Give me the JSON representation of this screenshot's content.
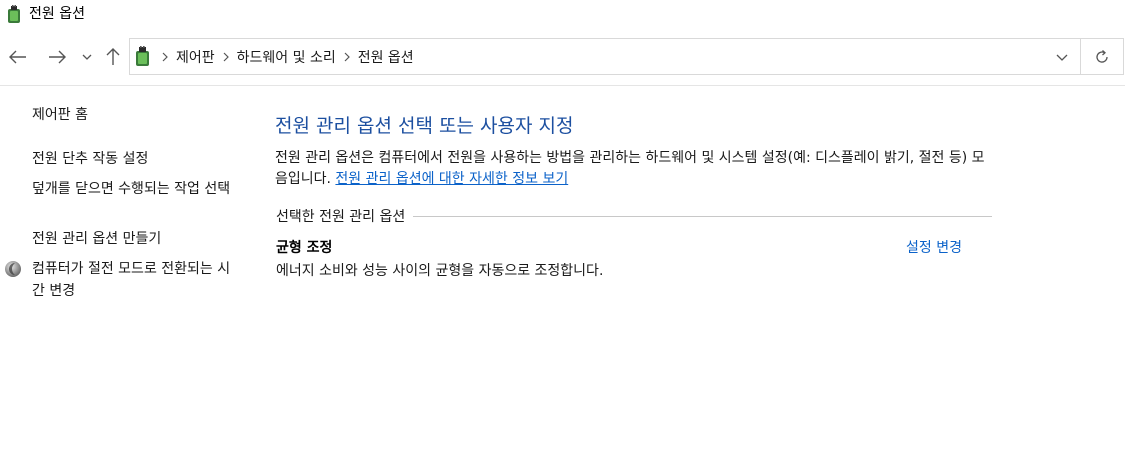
{
  "window": {
    "title": "전원 옵션",
    "icon": "power-options-icon"
  },
  "nav": {
    "back_icon": "arrow-left-icon",
    "forward_icon": "arrow-right-icon",
    "recent_icon": "chevron-down-icon",
    "up_icon": "arrow-up-icon",
    "refresh_icon": "refresh-icon",
    "dropdown_icon": "chevron-down-icon"
  },
  "address": {
    "breadcrumbs": [
      "제어판",
      "하드웨어 및 소리",
      "전원 옵션"
    ]
  },
  "sidebar": {
    "home": "제어판 홈",
    "items": [
      "전원 단추 작동 설정",
      "덮개를 닫으면 수행되는 작업 선택",
      "전원 관리 옵션 만들기",
      "컴퓨터가 절전 모드로 전환되는 시간 변경"
    ]
  },
  "main": {
    "title": "전원 관리 옵션 선택 또는 사용자 지정",
    "description": "전원 관리 옵션은 컴퓨터에서 전원을 사용하는 방법을 관리하는 하드웨어 및 시스템 설정(예: 디스플레이 밝기, 절전 등) 모음입니다. ",
    "info_link": "전원 관리 옵션에 대한 자세한 정보 보기",
    "section_label": "선택한 전원 관리 옵션",
    "plan": {
      "name": "균형 조정",
      "change_link": "설정 변경",
      "description": "에너지 소비와 성능 사이의 균형을 자동으로 조정합니다."
    }
  },
  "colors": {
    "title_blue": "#1c4fa0",
    "link_blue": "#0b62c9",
    "border": "#d9d9d9"
  }
}
